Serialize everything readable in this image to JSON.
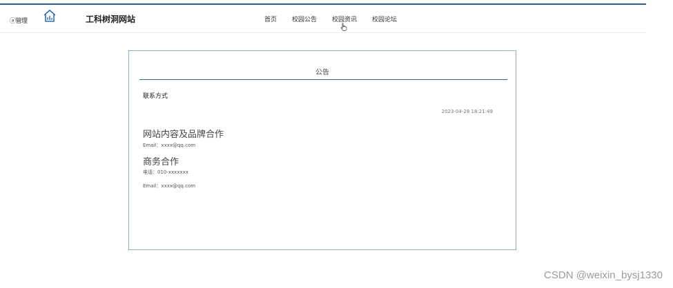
{
  "header": {
    "left_label": "ⓐ管理",
    "site_title": "工科树洞网站",
    "nav": [
      {
        "label": "首页"
      },
      {
        "label": "校园公告"
      },
      {
        "label": "校园资讯"
      },
      {
        "label": "校园论坛"
      }
    ]
  },
  "card": {
    "title": "公告",
    "article_title": "联系方式",
    "time": "2023-04-28 18:21:49",
    "sections": [
      {
        "heading": "网站内容及品牌合作",
        "lines": [
          "Email：xxxx@qq.com"
        ]
      },
      {
        "heading": "商务合作",
        "lines": [
          "电话：010-xxxxxxx",
          "Email：xxxx@qq.com"
        ]
      }
    ]
  },
  "watermark": "CSDN @weixin_bysj1330",
  "colors": {
    "accent": "#2f5d8f",
    "card_border": "#8fb0b8",
    "logo": "#2f6fb5"
  },
  "icons": {
    "logo": "home-chart-icon",
    "cursor": "hand-pointer-icon"
  }
}
